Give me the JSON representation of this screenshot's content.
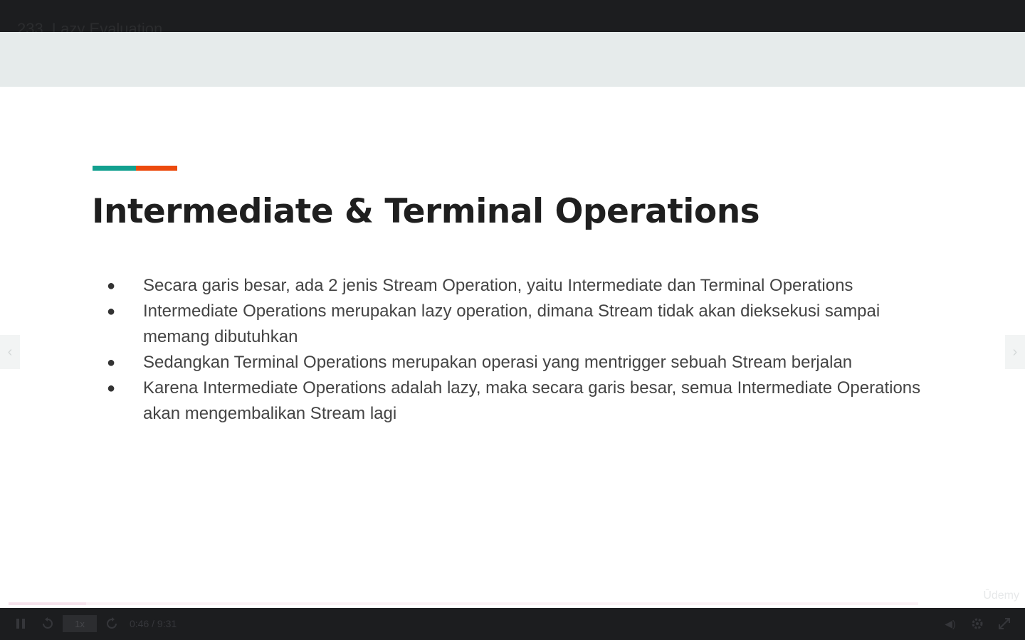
{
  "player": {
    "lecture_title": "233. Lazy Evaluation",
    "watermark": "Ûdemy",
    "progress_fraction": 0.085,
    "current_time": "0:46",
    "separator": "/",
    "duration": "9:31",
    "speed": "1x",
    "volume_glyph": "◀)",
    "prev_glyph": "‹",
    "next_glyph": "›"
  },
  "slide": {
    "title": "Intermediate & Terminal Operations",
    "bullets": [
      "Secara garis besar, ada 2 jenis Stream Operation, yaitu Intermediate dan Terminal Operations",
      "Intermediate Operations merupakan lazy operation, dimana Stream tidak akan dieksekusi sampai memang dibutuhkan",
      "Sedangkan Terminal Operations merupakan operasi yang mentrigger sebuah Stream berjalan",
      "Karena Intermediate Operations adalah lazy, maka secara garis besar, semua Intermediate Operations akan mengembalikan Stream lagi"
    ],
    "bullet_glyph": "●"
  },
  "colors": {
    "accent_teal": "#12a08f",
    "accent_orange": "#ec4a0d",
    "heading": "#1f1f1f",
    "header_band": "#e6ebeb",
    "player_bg": "#1c1d1f"
  },
  "icons": {
    "play": "pause-icon",
    "rewind": "rewind-5-icon",
    "forward": "forward-5-icon",
    "settings": "gear-icon",
    "expand": "expand-icon"
  }
}
